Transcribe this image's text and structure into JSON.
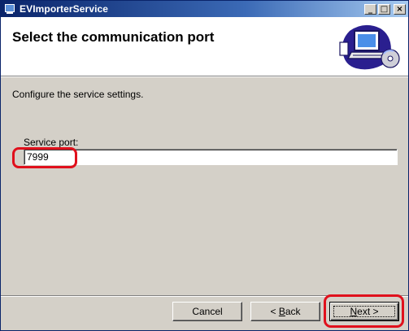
{
  "window": {
    "title": "EVImporterService",
    "controls": {
      "minimize": "_",
      "maximize": "□",
      "close": "×"
    }
  },
  "header": {
    "title": "Select the communication port",
    "graphic": "computer-disc-icon"
  },
  "main": {
    "instruction": "Configure the service settings.",
    "port_label": "Service port:",
    "port_value": "7999"
  },
  "buttons": {
    "cancel": "Cancel",
    "back_prefix": "< ",
    "back_mnemonic": "B",
    "back_rest": "ack",
    "next_mnemonic": "N",
    "next_rest": "ext >"
  },
  "colors": {
    "annotation": "#e0101c",
    "titlebar": "#0a246a",
    "dialog_bg": "#d4d0c8"
  }
}
